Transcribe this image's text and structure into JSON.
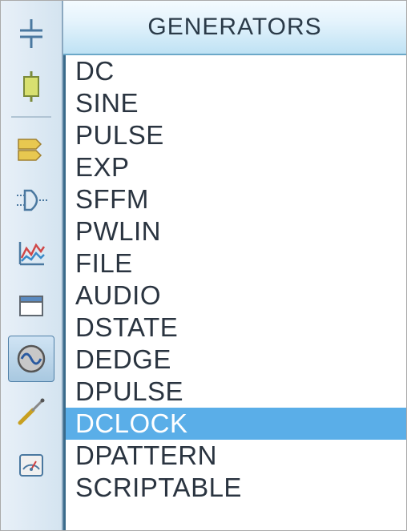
{
  "header": {
    "title": "GENERATORS"
  },
  "toolbar": {
    "items": [
      {
        "name": "selection-mode",
        "selected": false
      },
      {
        "name": "component-mode",
        "selected": false
      },
      {
        "name": "label-mode",
        "selected": false
      },
      {
        "name": "gate-mode",
        "selected": false
      },
      {
        "name": "graph-mode",
        "selected": false
      },
      {
        "name": "window-mode",
        "selected": false
      },
      {
        "name": "generator-mode",
        "selected": true
      },
      {
        "name": "probe-mode",
        "selected": false
      },
      {
        "name": "meter-mode",
        "selected": false
      }
    ]
  },
  "generators": {
    "items": [
      {
        "label": "DC",
        "selected": false
      },
      {
        "label": "SINE",
        "selected": false
      },
      {
        "label": "PULSE",
        "selected": false
      },
      {
        "label": "EXP",
        "selected": false
      },
      {
        "label": "SFFM",
        "selected": false
      },
      {
        "label": "PWLIN",
        "selected": false
      },
      {
        "label": "FILE",
        "selected": false
      },
      {
        "label": "AUDIO",
        "selected": false
      },
      {
        "label": "DSTATE",
        "selected": false
      },
      {
        "label": "DEDGE",
        "selected": false
      },
      {
        "label": "DPULSE",
        "selected": false
      },
      {
        "label": "DCLOCK",
        "selected": true
      },
      {
        "label": "DPATTERN",
        "selected": false
      },
      {
        "label": "SCRIPTABLE",
        "selected": false
      }
    ]
  }
}
